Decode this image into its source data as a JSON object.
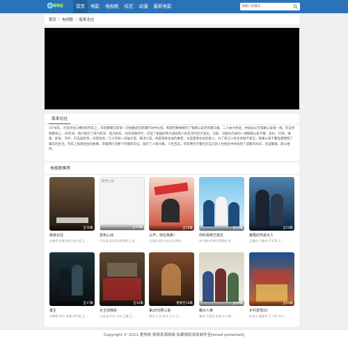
{
  "header": {
    "logo_text": "零零猫",
    "nav": [
      "首页",
      "电影",
      "电视剧",
      "综艺",
      "动漫",
      "最新电影"
    ],
    "search_placeholder": "请输入关键词..."
  },
  "breadcrumb": [
    "首页",
    "电视剧",
    "南来北往"
  ],
  "colors": {
    "topbar": "#2b73b8",
    "background": "#f0f0f0",
    "panel": "#ffffff"
  },
  "description": {
    "title": "南来北往",
    "text": "1978年，大连开往三棵树的列车上，年轻乘警汪新第一次执勤就在抓捕行动中负伤。和冒险乘横德开了铁路公安老民警马魁。二人扶为师徒，并肩战斗在铁路公安第一线。在这条铁路线上，40年间，他们经历了蒸汽机车、电力机车、动车高铁时代，见证了祖国的伟大成就和人民生活的巨大变化。汪新、马魁为代表的一线铁路公安干警，反扒、打拐、缉毒、抓逃、守护，打击盗抢等，扫黑除恶，几十年如一日破大案、解决小案。他是南来北往的乘客，也是南来北往的旅人。为了保卫人民生命财产安全，铁路公安干警甘愿牺牲了童年的生活。列车上来来往往的故事，带着我们对那个时期的印记，展示了人情冷暖，人生百态。新老两代干警也在自己的人生经历中体验到了温暖的升华，忠诚警魂，薪火相传。"
  },
  "recommend": {
    "title": "电视剧推荐",
    "items": [
      {
        "name": "南来北往",
        "sub": "白敬亭,金晨,胡军,张小斐,王...",
        "badge": "全36集"
      },
      {
        "name": "替色心动",
        "sub": "代言视,爱谷雨,蔡明刚,王沫...",
        "badge": "全24集",
        "alt": "替色心动"
      },
      {
        "name": "让开，别在我爽！",
        "sub": "马思超,周宇,赵文龙,周思...",
        "badge": "全16集"
      },
      {
        "name": "你的毒枪已抵达",
        "sub": "李子璐,宋宗明,蔡佩松,余...",
        "badge": "全12集"
      },
      {
        "name": "春霞的司进大人",
        "sub": "王耀庆,马敬伟,芦芳草,王...",
        "badge": "全20集"
      },
      {
        "name": "勇生",
        "sub": "苏鹤栩,常兵,张鹰,郝宇超,王...",
        "badge": "全17集"
      },
      {
        "name": "大王别慌张",
        "sub": "王彧,赵子杰,马东,王耀,王...",
        "badge": "全34集"
      },
      {
        "name": "第20光照三丧",
        "sub": "杨洋,王月,何冰,王卡,王...",
        "badge": "更新至10集"
      },
      {
        "name": "棚大人第",
        "sub": "秦旭,马昊亮,朱晶,宋小琳,...",
        "badge": "全40集"
      },
      {
        "name": "乡村爱情15",
        "sub": "赵本山,唐鉴军,王小利,刘小...",
        "badge": "全40集"
      }
    ]
  },
  "footer": {
    "text": "Copyright © 2021 爱热网 视频来源网络 如果侵权请发邮件至[email protected]"
  }
}
